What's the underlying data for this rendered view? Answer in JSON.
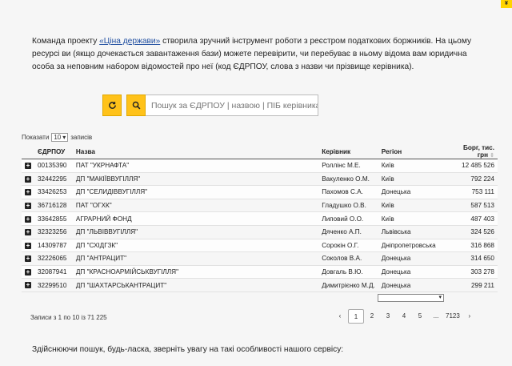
{
  "corner_badge": "¥",
  "intro": {
    "before": "Команда проекту ",
    "link": "«Ціна держави»",
    "after": " створила зручний інструмент роботи з реєстром податкових боржників. На цьому ресурсі ви (якщо дочекається завантаження бази) можете перевірити, чи перебуває в ньому відома вам юридична особа за неповним набором відомостей про неї (код ЄДРПОУ, слова з назви чи прізвище керівника)."
  },
  "search": {
    "placeholder": "Пошук за ЄДРПОУ | назвою | ПІБ керівника",
    "refresh_icon": "refresh-icon",
    "search_icon": "search-icon",
    "accent": "#ffc21a"
  },
  "length": {
    "before": "Показати",
    "value": "10",
    "after": "записів"
  },
  "table": {
    "headers": {
      "code": "ЄДРПОУ",
      "name": "Назва",
      "head": "Керівник",
      "region": "Регіон",
      "debt": "Борг, тис. грн"
    },
    "rows": [
      {
        "code": "00135390",
        "name": "ПАТ \"УКРНАФТА\"",
        "head": "Роллінс М.Е.",
        "region": "Київ",
        "debt": "12 485 526"
      },
      {
        "code": "32442295",
        "name": "ДП \"МАКІЇВВУГІЛЛЯ\"",
        "head": "Вакуленко О.М.",
        "region": "Київ",
        "debt": "792 224"
      },
      {
        "code": "33426253",
        "name": "ДП \"СЕЛИДІВВУГІЛЛЯ\"",
        "head": "Пахомов С.А.",
        "region": "Донецька",
        "debt": "753 111"
      },
      {
        "code": "36716128",
        "name": "ПАТ \"ОГХК\"",
        "head": "Гладушко О.В.",
        "region": "Київ",
        "debt": "587 513"
      },
      {
        "code": "33642855",
        "name": "АГРАРНИЙ ФОНД",
        "head": "Липовий О.О.",
        "region": "Київ",
        "debt": "487 403"
      },
      {
        "code": "32323256",
        "name": "ДП \"ЛЬВІВВУГІЛЛЯ\"",
        "head": "Дяченко А.П.",
        "region": "Львівська",
        "debt": "324 526"
      },
      {
        "code": "14309787",
        "name": "ДП \"СХІДГЗК\"",
        "head": "Сорокін О.Г.",
        "region": "Дніпропетровська",
        "debt": "316 868"
      },
      {
        "code": "32226065",
        "name": "ДП \"АНТРАЦИТ\"",
        "head": "Соколов В.А.",
        "region": "Донецька",
        "debt": "314 650"
      },
      {
        "code": "32087941",
        "name": "ДП \"КРАСНОАРМІЙСЬКВУГІЛЛЯ\"",
        "head": "Довгаль В.Ю.",
        "region": "Донецька",
        "debt": "303 278"
      },
      {
        "code": "32299510",
        "name": "ДП \"ШАХТАРСЬКАНТРАЦИТ\"",
        "head": "Димитрієнко М.Д.",
        "region": "Донецька",
        "debt": "299 211"
      }
    ]
  },
  "info": "Записи з 1 по 10 із 71 225",
  "pager": {
    "prev": "‹",
    "pages": [
      "1",
      "2",
      "3",
      "4",
      "5",
      "...",
      "7123"
    ],
    "next": "›",
    "active": "1"
  },
  "footer": "Здійснюючи пошук, будь-ласка, зверніть увагу на такі особливості нашого сервісу:"
}
